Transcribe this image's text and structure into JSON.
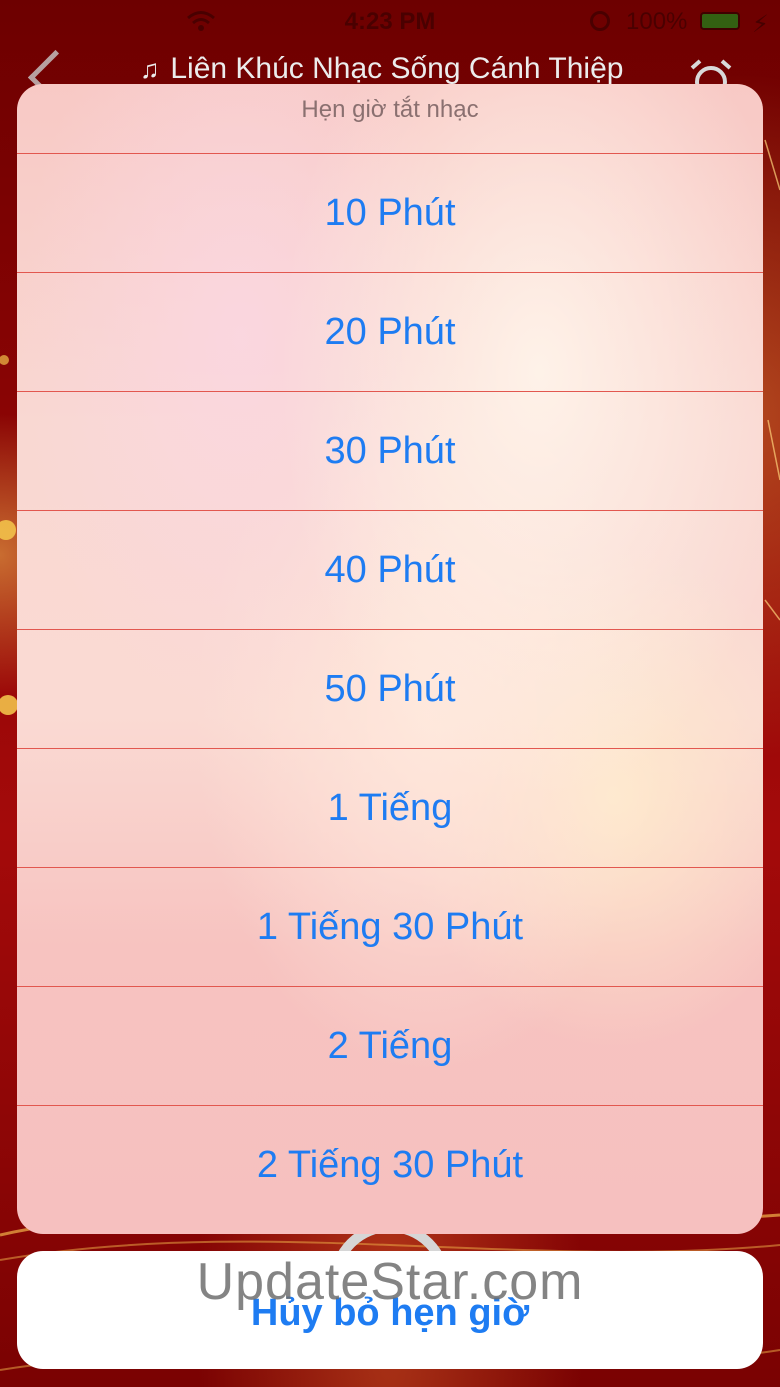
{
  "status_bar": {
    "time": "4:23 PM",
    "battery": "100%",
    "icons": [
      "wifi-icon",
      "orientation-lock-icon",
      "battery-icon",
      "charging-icon"
    ]
  },
  "nav": {
    "title": "Liên Khúc Nhạc Sống Cánh Thiệp",
    "icons": [
      "back-icon",
      "music-note-icon",
      "alarm-clock-icon"
    ]
  },
  "sheet": {
    "title": "Hẹn giờ tắt nhạc",
    "options": [
      "10 Phút",
      "20 Phút",
      "30 Phút",
      "40 Phút",
      "50 Phút",
      "1 Tiếng",
      "1 Tiếng 30 Phút",
      "2 Tiếng",
      "2 Tiếng 30 Phút"
    ],
    "cancel_label": "Hủy bỏ hẹn giờ"
  },
  "watermark": "UpdateStar.com",
  "colors": {
    "accent": "#1e7cf2",
    "separator": "#e2574f",
    "background": "#8a0404"
  }
}
